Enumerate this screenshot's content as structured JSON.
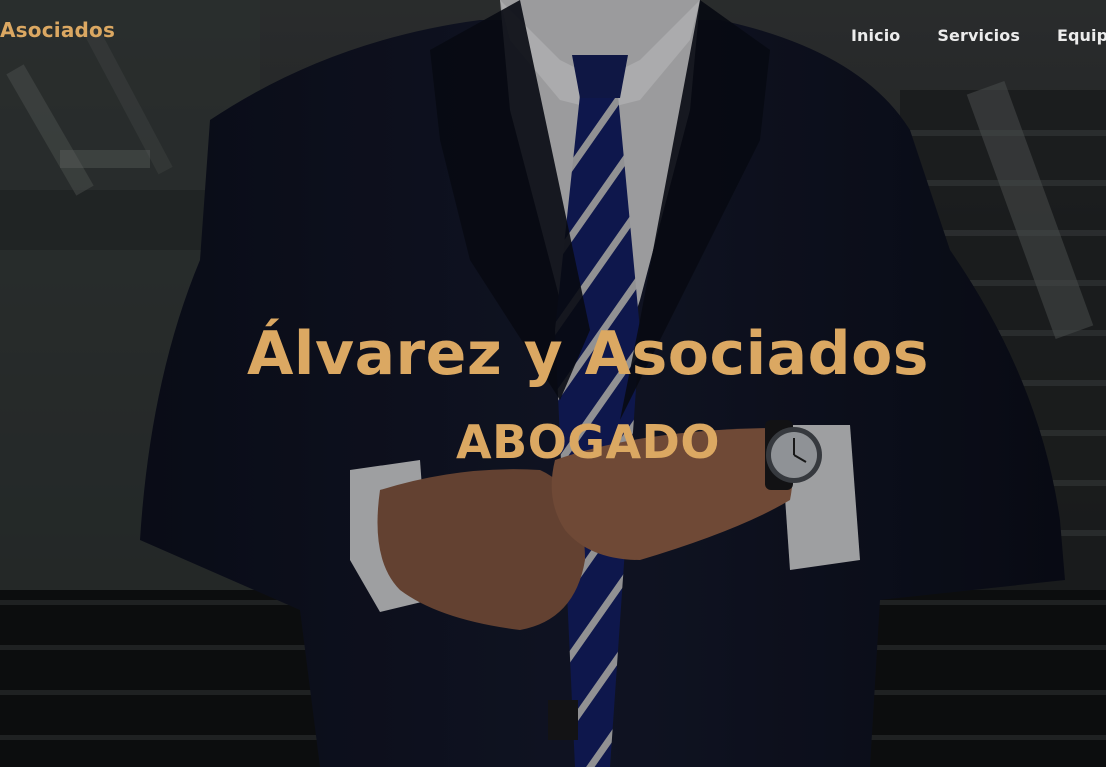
{
  "navbar": {
    "brand": "Asociados",
    "links": [
      {
        "label": "Inicio"
      },
      {
        "label": "Servicios"
      },
      {
        "label": "Equipo"
      }
    ]
  },
  "hero": {
    "title": "Álvarez y Asociados",
    "subtitle": "ABOGADO",
    "background_image": "man in dark suit with striped tie and wristwatch buttoning jacket in front of staircase"
  },
  "colors": {
    "accent": "#dba862",
    "nav_text": "#ececec",
    "suit": "#14182a"
  }
}
